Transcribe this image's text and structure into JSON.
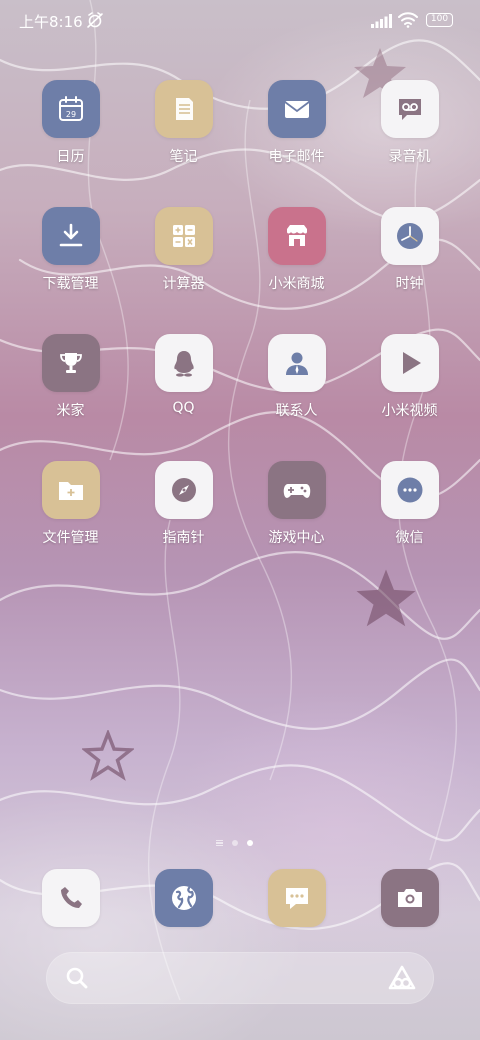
{
  "status_bar": {
    "time": "上午8:16",
    "battery": "100"
  },
  "apps": [
    {
      "label": "日历",
      "icon": "calendar-icon",
      "bg": "#6e7ea8",
      "glyph_color": "#ffffff",
      "day": "29"
    },
    {
      "label": "笔记",
      "icon": "notes-icon",
      "bg": "#d8c196",
      "glyph_color": "#ffffff"
    },
    {
      "label": "电子邮件",
      "icon": "mail-icon",
      "bg": "#6e7ea8",
      "glyph_color": "#ffffff"
    },
    {
      "label": "录音机",
      "icon": "voicemail-icon",
      "bg": "#f5f4f6",
      "glyph_color": "#8b7483"
    },
    {
      "label": "下载管理",
      "icon": "download-icon",
      "bg": "#6e7ea8",
      "glyph_color": "#ffffff"
    },
    {
      "label": "计算器",
      "icon": "calculator-icon",
      "bg": "#d8c196",
      "glyph_color": "#ffffff"
    },
    {
      "label": "小米商城",
      "icon": "store-icon",
      "bg": "#c9728c",
      "glyph_color": "#ffffff"
    },
    {
      "label": "时钟",
      "icon": "clock-icon",
      "bg": "#f5f4f6",
      "glyph_color": "#6e7ea8"
    },
    {
      "label": "米家",
      "icon": "trophy-icon",
      "bg": "#8b7483",
      "glyph_color": "#ffffff"
    },
    {
      "label": "QQ",
      "icon": "penguin-icon",
      "bg": "#f5f4f6",
      "glyph_color": "#8b7483"
    },
    {
      "label": "联系人",
      "icon": "contact-icon",
      "bg": "#f5f4f6",
      "glyph_color": "#6e7ea8"
    },
    {
      "label": "小米视频",
      "icon": "play-icon",
      "bg": "#f5f4f6",
      "glyph_color": "#8b7483"
    },
    {
      "label": "文件管理",
      "icon": "folder-icon",
      "bg": "#d8c196",
      "glyph_color": "#ffffff"
    },
    {
      "label": "指南针",
      "icon": "compass-icon",
      "bg": "#f5f4f6",
      "glyph_color": "#8b7483"
    },
    {
      "label": "游戏中心",
      "icon": "gamepad-icon",
      "bg": "#8b7483",
      "glyph_color": "#ffffff"
    },
    {
      "label": "微信",
      "icon": "chat-bubble-icon",
      "bg": "#f5f4f6",
      "glyph_color": "#6e7ea8"
    }
  ],
  "dock": [
    {
      "icon": "phone-icon",
      "bg": "#f5f4f6",
      "glyph_color": "#8b7483"
    },
    {
      "icon": "browser-globe-icon",
      "bg": "#6e7ea8",
      "glyph_color": "#ffffff"
    },
    {
      "icon": "messages-icon",
      "bg": "#d8c196",
      "glyph_color": "#ffffff"
    },
    {
      "icon": "camera-icon",
      "bg": "#8b7483",
      "glyph_color": "#ffffff"
    }
  ],
  "page_indicator": {
    "pages": 3,
    "active": 3
  },
  "search_bar": {
    "icon": "search-icon",
    "assistant_icon": "assistant-icon"
  }
}
